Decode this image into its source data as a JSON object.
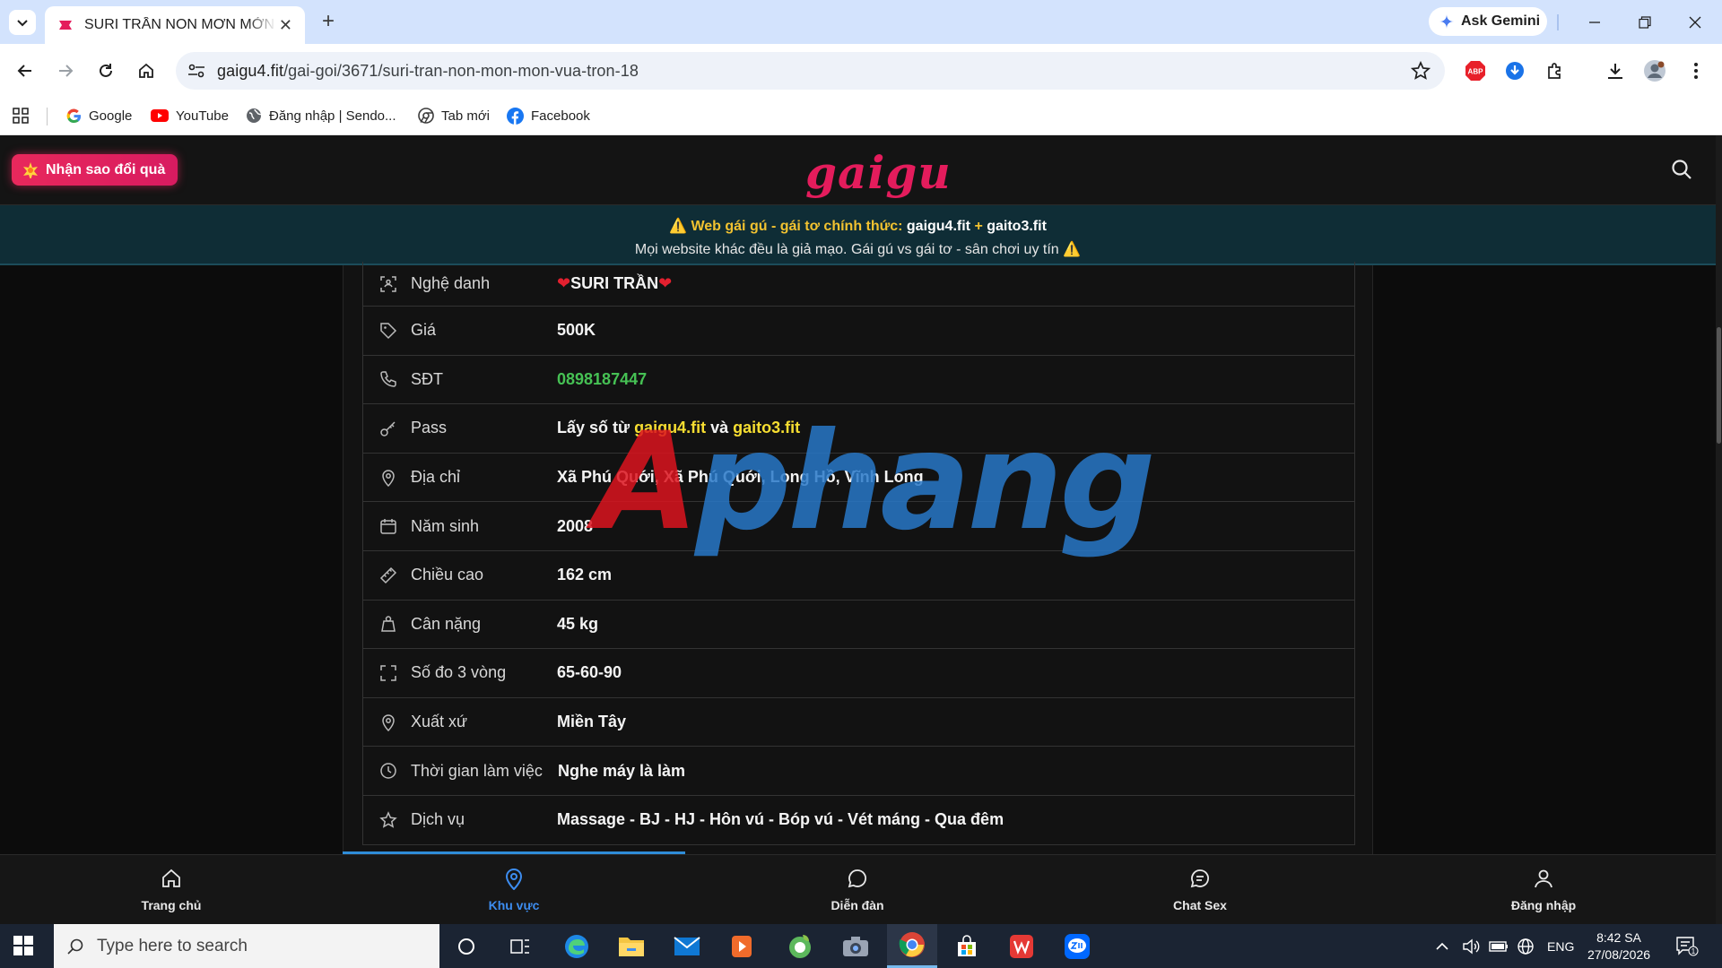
{
  "browser": {
    "tab_title": "SURI TRẦN NON MƠN MỞN VỪ",
    "tab_close": "✕",
    "new_tab": "+",
    "gemini_label": "Ask Gemini",
    "url_host": "gaigu4.fit",
    "url_path": "/gai-goi/3671/suri-tran-non-mon-mon-vua-tron-18",
    "abp_label": "ABP",
    "bookmarks": [
      {
        "label": "Google",
        "icon": "google-icon"
      },
      {
        "label": "YouTube",
        "icon": "youtube-icon"
      },
      {
        "label": "Đăng nhập | Sendo...",
        "icon": "globe-icon"
      },
      {
        "label": "Tab mới",
        "icon": "chrome-tab-icon"
      },
      {
        "label": "Facebook",
        "icon": "facebook-icon"
      }
    ]
  },
  "site": {
    "reward_button": "Nhận sao đổi quà",
    "logo": "gaigu",
    "notice": {
      "line1_prefix": "Web gái gú - gái tơ chính thức: ",
      "domain1": "gaigu4.fit",
      "plus": " + ",
      "domain2": "gaito3.fit",
      "line2": "Mọi website khác đều là giả mạo. Gái gú vs gái tơ - sân chơi uy tín"
    },
    "profile": {
      "rows": [
        {
          "label": "Nghệ danh",
          "value": "SURI TRẦN",
          "icon": "user-scan-icon"
        },
        {
          "label": "Giá",
          "value": "500K",
          "icon": "tag-icon"
        },
        {
          "label": "SĐT",
          "value": "0898187447",
          "icon": "phone-icon"
        },
        {
          "label": "Pass",
          "value_prefix": "Lấy số từ ",
          "value_link1": "gaigu4.fit",
          "value_mid": " và ",
          "value_link2": "gaito3.fit",
          "icon": "key-icon"
        },
        {
          "label": "Địa chỉ",
          "value": "Xã Phú Quới, Xã Phú Quới, Long Hồ, Vĩnh Long",
          "icon": "map-pin-icon"
        },
        {
          "label": "Năm sinh",
          "value": "2008",
          "icon": "calendar-icon"
        },
        {
          "label": "Chiều cao",
          "value": "162 cm",
          "icon": "ruler-icon"
        },
        {
          "label": "Cân nặng",
          "value": "45 kg",
          "icon": "weight-icon"
        },
        {
          "label": "Số đo 3 vòng",
          "value": "65-60-90",
          "icon": "frame-icon"
        },
        {
          "label": "Xuất xứ",
          "value": "Miền Tây",
          "icon": "map-pin-icon"
        },
        {
          "label": "Thời gian làm việc",
          "value": "Nghe máy là làm",
          "icon": "clock-icon"
        },
        {
          "label": "Dịch vụ",
          "value": "Massage - BJ - HJ - Hôn vú - Bóp vú - Vét máng - Qua đêm",
          "icon": "star-icon"
        }
      ]
    },
    "watermark_a": "A",
    "watermark_b": "phang",
    "bottom_nav": [
      {
        "label": "Trang chủ",
        "icon": "home-icon"
      },
      {
        "label": "Khu vực",
        "icon": "location-icon",
        "active": true
      },
      {
        "label": "Diễn đàn",
        "icon": "chat-bubble-icon"
      },
      {
        "label": "Chat Sex",
        "icon": "chat-lines-icon"
      },
      {
        "label": "Đăng nhập",
        "icon": "user-icon"
      }
    ]
  },
  "taskbar": {
    "search_placeholder": "Type here to search",
    "language": "ENG",
    "time": "8:42 SA",
    "date": "27/08/2026",
    "notification_count": "1"
  },
  "colors": {
    "accent_pink": "#e41c5c",
    "notice_bg": "#0f2d36",
    "phone_green": "#46c154",
    "link_yellow": "#f7de31",
    "active_blue": "#3d8df0"
  }
}
